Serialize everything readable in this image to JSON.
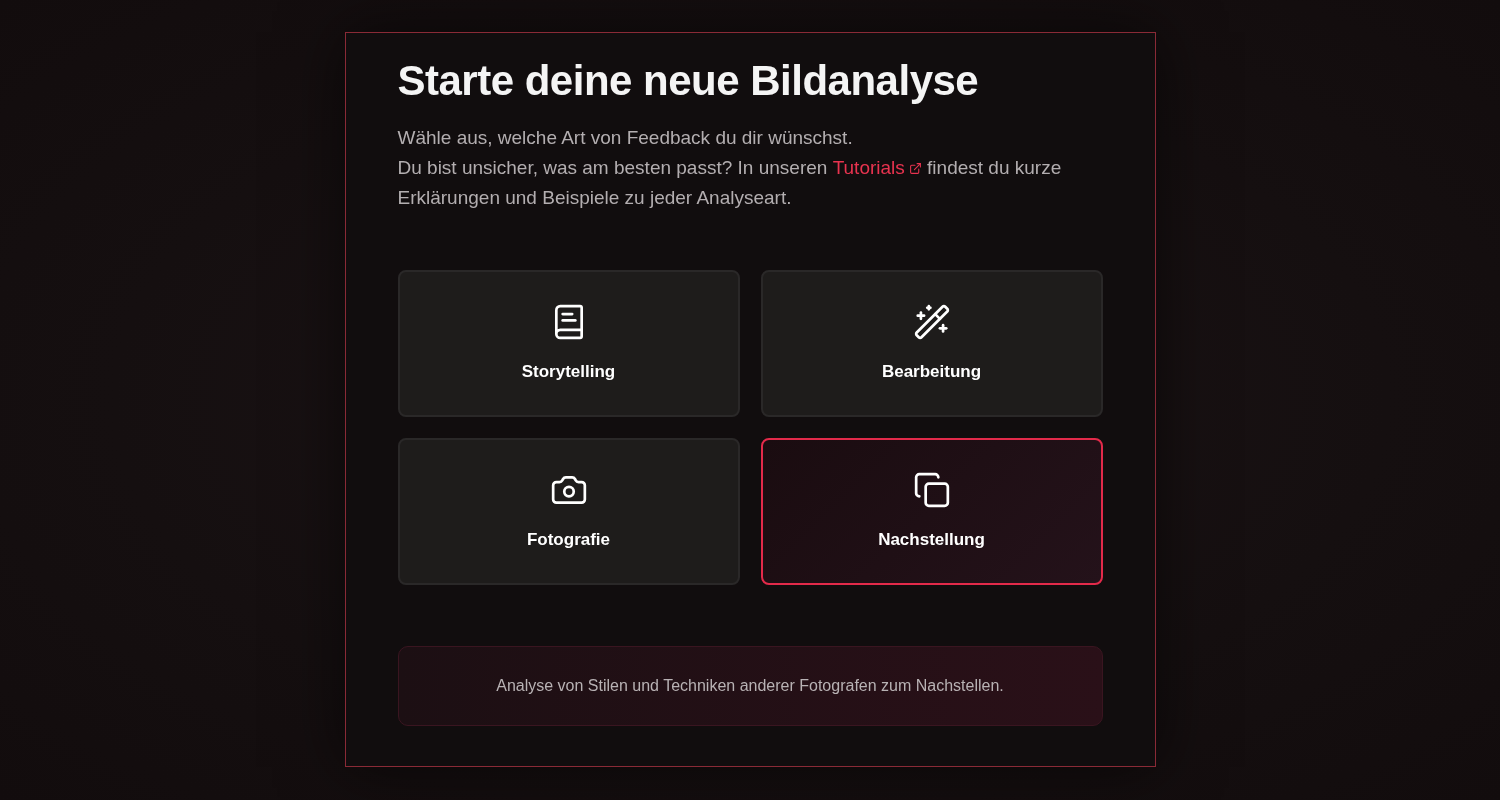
{
  "title": "Starte deine neue Bildanalyse",
  "intro": {
    "line1": "Wähle aus, welche Art von Feedback du dir wünschst.",
    "before_link": "Du bist unsicher, was am besten passt? In unseren ",
    "link": "Tutorials",
    "after_link": " findest du kurze Erklärungen und Beispiele zu jeder Analyseart."
  },
  "options": [
    {
      "label": "Storytelling",
      "selected": false
    },
    {
      "label": "Bearbeitung",
      "selected": false
    },
    {
      "label": "Fotografie",
      "selected": false
    },
    {
      "label": "Nachstellung",
      "selected": true
    }
  ],
  "description": "Analyse von Stilen und Techniken anderer Fotografen zum Nachstellen."
}
